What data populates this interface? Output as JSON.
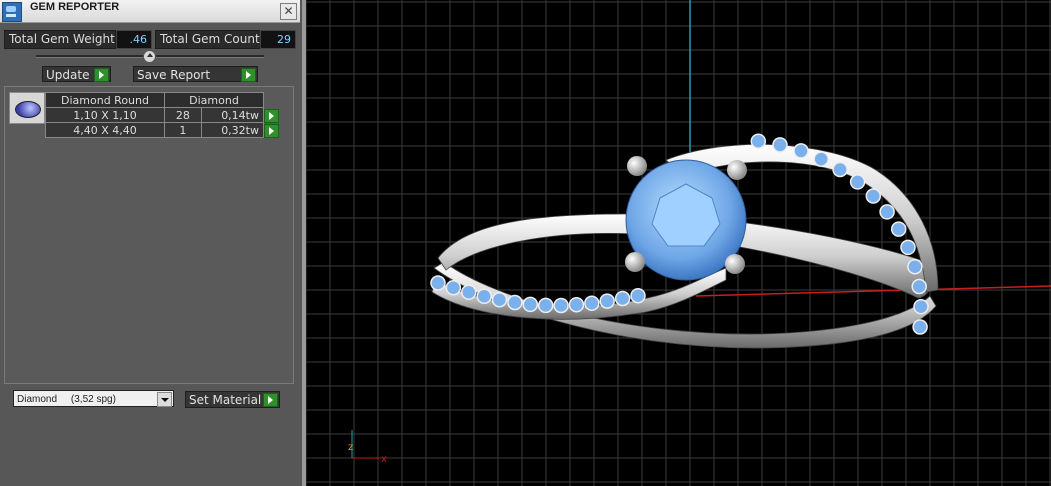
{
  "window": {
    "title": "GEM REPORTER",
    "close": "✕"
  },
  "stats": {
    "weight_label": "Total Gem Weight",
    "weight_value": ".46",
    "count_label": "Total Gem Count",
    "count_value": "29"
  },
  "buttons": {
    "update": "Update",
    "save_report": "Save Report",
    "set_material": "Set Material"
  },
  "table": {
    "headers": [
      "Diamond Round",
      "Diamond"
    ],
    "rows": [
      {
        "size": "1,10 X 1,10",
        "count": "28",
        "weight": "0,14tw"
      },
      {
        "size": "4,40 X 4,40",
        "count": "1",
        "weight": "0,32tw"
      }
    ]
  },
  "material": {
    "selected": "Diamond     (3,52 spg)"
  },
  "axis": {
    "x": "x",
    "z": "z"
  },
  "colors": {
    "gem_blue": "#7ab0ec",
    "grid": "#3c3c3c",
    "x_axis": "#c81e1e",
    "z_axis": "#1ea0b4"
  }
}
